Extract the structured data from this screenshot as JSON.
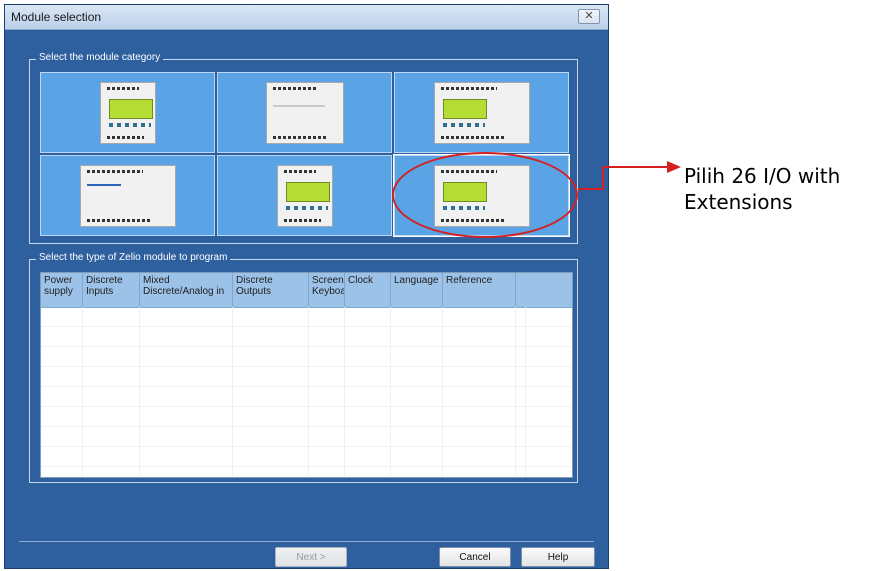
{
  "dialog": {
    "title": "Module selection",
    "close_glyph": "✕"
  },
  "category_group": {
    "label": "Select the module category",
    "tiles": [
      {
        "size": "small"
      },
      {
        "size": "medium"
      },
      {
        "size": "large"
      },
      {
        "size": "large"
      },
      {
        "size": "small"
      },
      {
        "size": "large",
        "selected": true
      }
    ]
  },
  "type_group": {
    "label": "Select the type of Zelio module to program",
    "columns": [
      "Power supply",
      "Discrete Inputs",
      "Mixed Discrete/Analog in",
      "Discrete Outputs",
      "Screen Keyboa",
      "Clock",
      "Language",
      "Reference"
    ],
    "rows": []
  },
  "buttons": {
    "next": "Next >",
    "cancel": "Cancel",
    "help": "Help"
  },
  "annotation": {
    "text": "Pilih 26 I/O with Extensions",
    "color": "#d42020"
  }
}
